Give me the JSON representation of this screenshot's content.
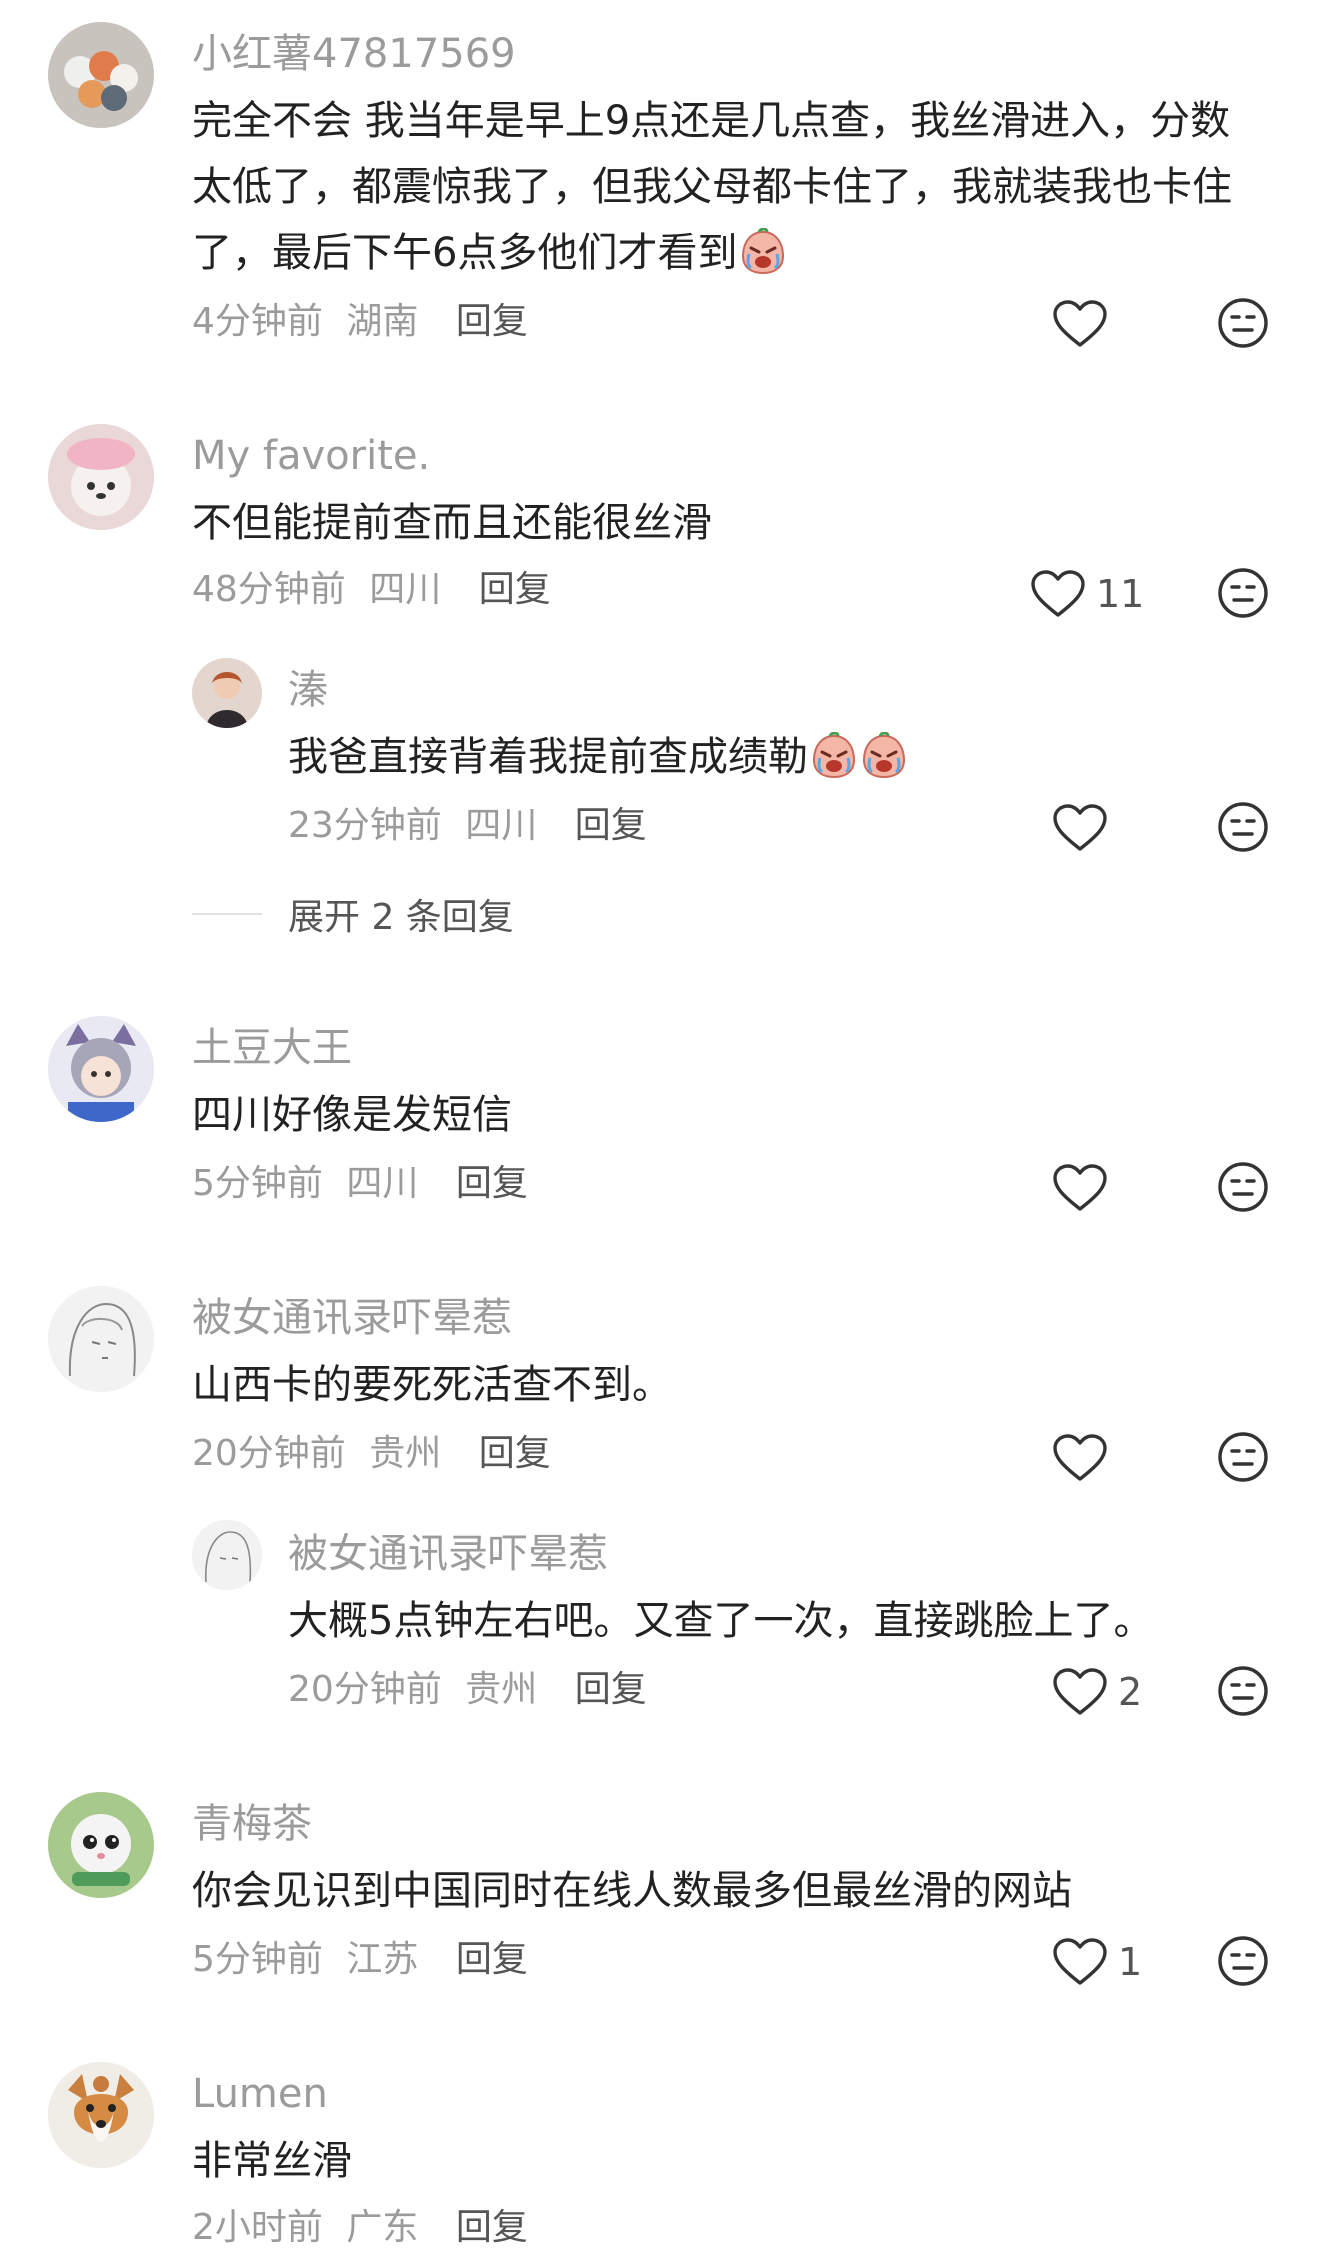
{
  "comments": [
    {
      "username": "小红薯47817569",
      "text": "完全不会 我当年是早上9点还是几点查，我丝滑进入，分数太低了，都震惊我了，但我父母都卡住了，我就装我也卡住了，最后下午6点多他们才看到",
      "time": "4分钟前",
      "location": "湖南",
      "reply_label": "回复",
      "likes": ""
    },
    {
      "username": "My favorite.",
      "text": "不但能提前查而且还能很丝滑",
      "time": "48分钟前",
      "location": "四川",
      "reply_label": "回复",
      "likes": "11",
      "replies": [
        {
          "username": "溱",
          "text": "我爸直接背着我提前查成绩勒",
          "time": "23分钟前",
          "location": "四川",
          "reply_label": "回复",
          "likes": ""
        }
      ],
      "expand_label": "展开 2 条回复"
    },
    {
      "username": "土豆大王",
      "text": "四川好像是发短信",
      "time": "5分钟前",
      "location": "四川",
      "reply_label": "回复",
      "likes": ""
    },
    {
      "username": "被女通讯录吓晕惹",
      "text": "山西卡的要死死活查不到。",
      "time": "20分钟前",
      "location": "贵州",
      "reply_label": "回复",
      "likes": "",
      "replies": [
        {
          "username": "被女通讯录吓晕惹",
          "text": "大概5点钟左右吧。又查了一次，直接跳脸上了。",
          "time": "20分钟前",
          "location": "贵州",
          "reply_label": "回复",
          "likes": "2"
        }
      ]
    },
    {
      "username": "青梅茶",
      "text": "你会见识到中国同时在线人数最多但最丝滑的网站",
      "time": "5分钟前",
      "location": "江苏",
      "reply_label": "回复",
      "likes": "1"
    },
    {
      "username": "Lumen",
      "text": "非常丝滑",
      "time": "2小时前",
      "location": "广东",
      "reply_label": "回复",
      "likes": ""
    }
  ],
  "icons": {
    "like": "heart-outline-icon",
    "dislike": "neutral-face-icon",
    "emoji": "crying-face-emoji"
  },
  "colors": {
    "username": "#9b9b9b",
    "text": "#222222",
    "meta": "#9b9b9b",
    "reply": "#555555"
  }
}
